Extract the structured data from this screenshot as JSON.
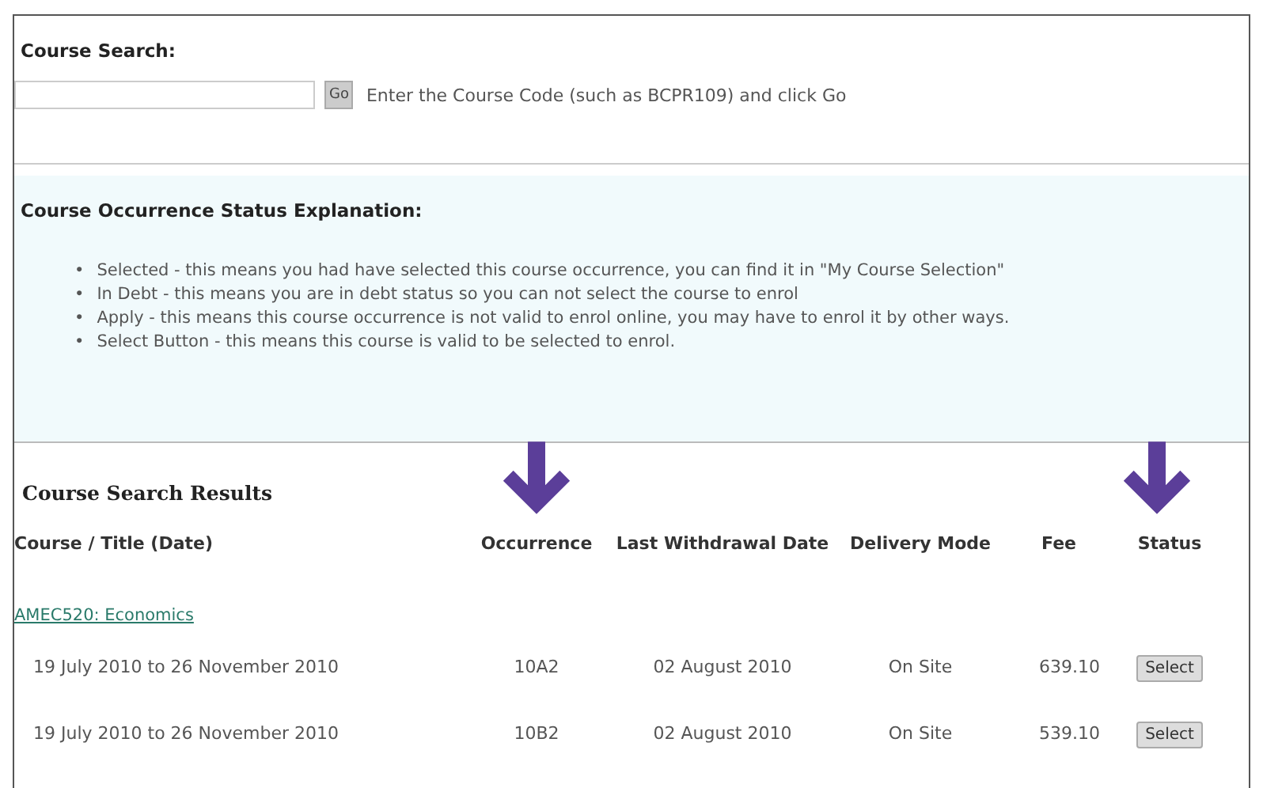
{
  "search": {
    "title": "Course Search:",
    "button": "Go",
    "hint": "Enter the Course Code (such as BCPR109) and click Go"
  },
  "explanation": {
    "title": "Course Occurrence Status Explanation:",
    "items": [
      {
        "bullet": "•",
        "text": "Selected - this means you had have selected this course occurrence, you can find it in \"My Course Selection\""
      },
      {
        "bullet": "•",
        "text": "In Debt - this means you are in debt status so you can not select the course to enrol"
      },
      {
        "bullet": "•",
        "text": "Apply - this means this course occurrence is not valid to enrol online, you may have to enrol it by other ways."
      },
      {
        "bullet": "•",
        "text": "Select Button - this means this course is valid to be selected to enrol."
      }
    ]
  },
  "results": {
    "title": "Course Search Results",
    "columns": [
      {
        "label": "Course / Title (Date)",
        "arrow": false
      },
      {
        "label": "Occurrence",
        "arrow": true
      },
      {
        "label": "Last Withdrawal Date",
        "arrow": false
      },
      {
        "label": "Delivery Mode",
        "arrow": false
      },
      {
        "label": "Fee",
        "arrow": false
      },
      {
        "label": "Status",
        "arrow": true
      }
    ],
    "course": "AMEC520: Economics",
    "rows": [
      {
        "date": "19 July 2010 to 26 November 2010",
        "occurrence": "10A2",
        "withdrawal": "02 August 2010",
        "mode": "On Site",
        "fee": "639.10",
        "status": "Select"
      },
      {
        "date": "19 July 2010 to 26 November 2010",
        "occurrence": "10B2",
        "withdrawal": "02 August 2010",
        "mode": "On Site",
        "fee": "539.10",
        "status": "Select"
      }
    ]
  }
}
